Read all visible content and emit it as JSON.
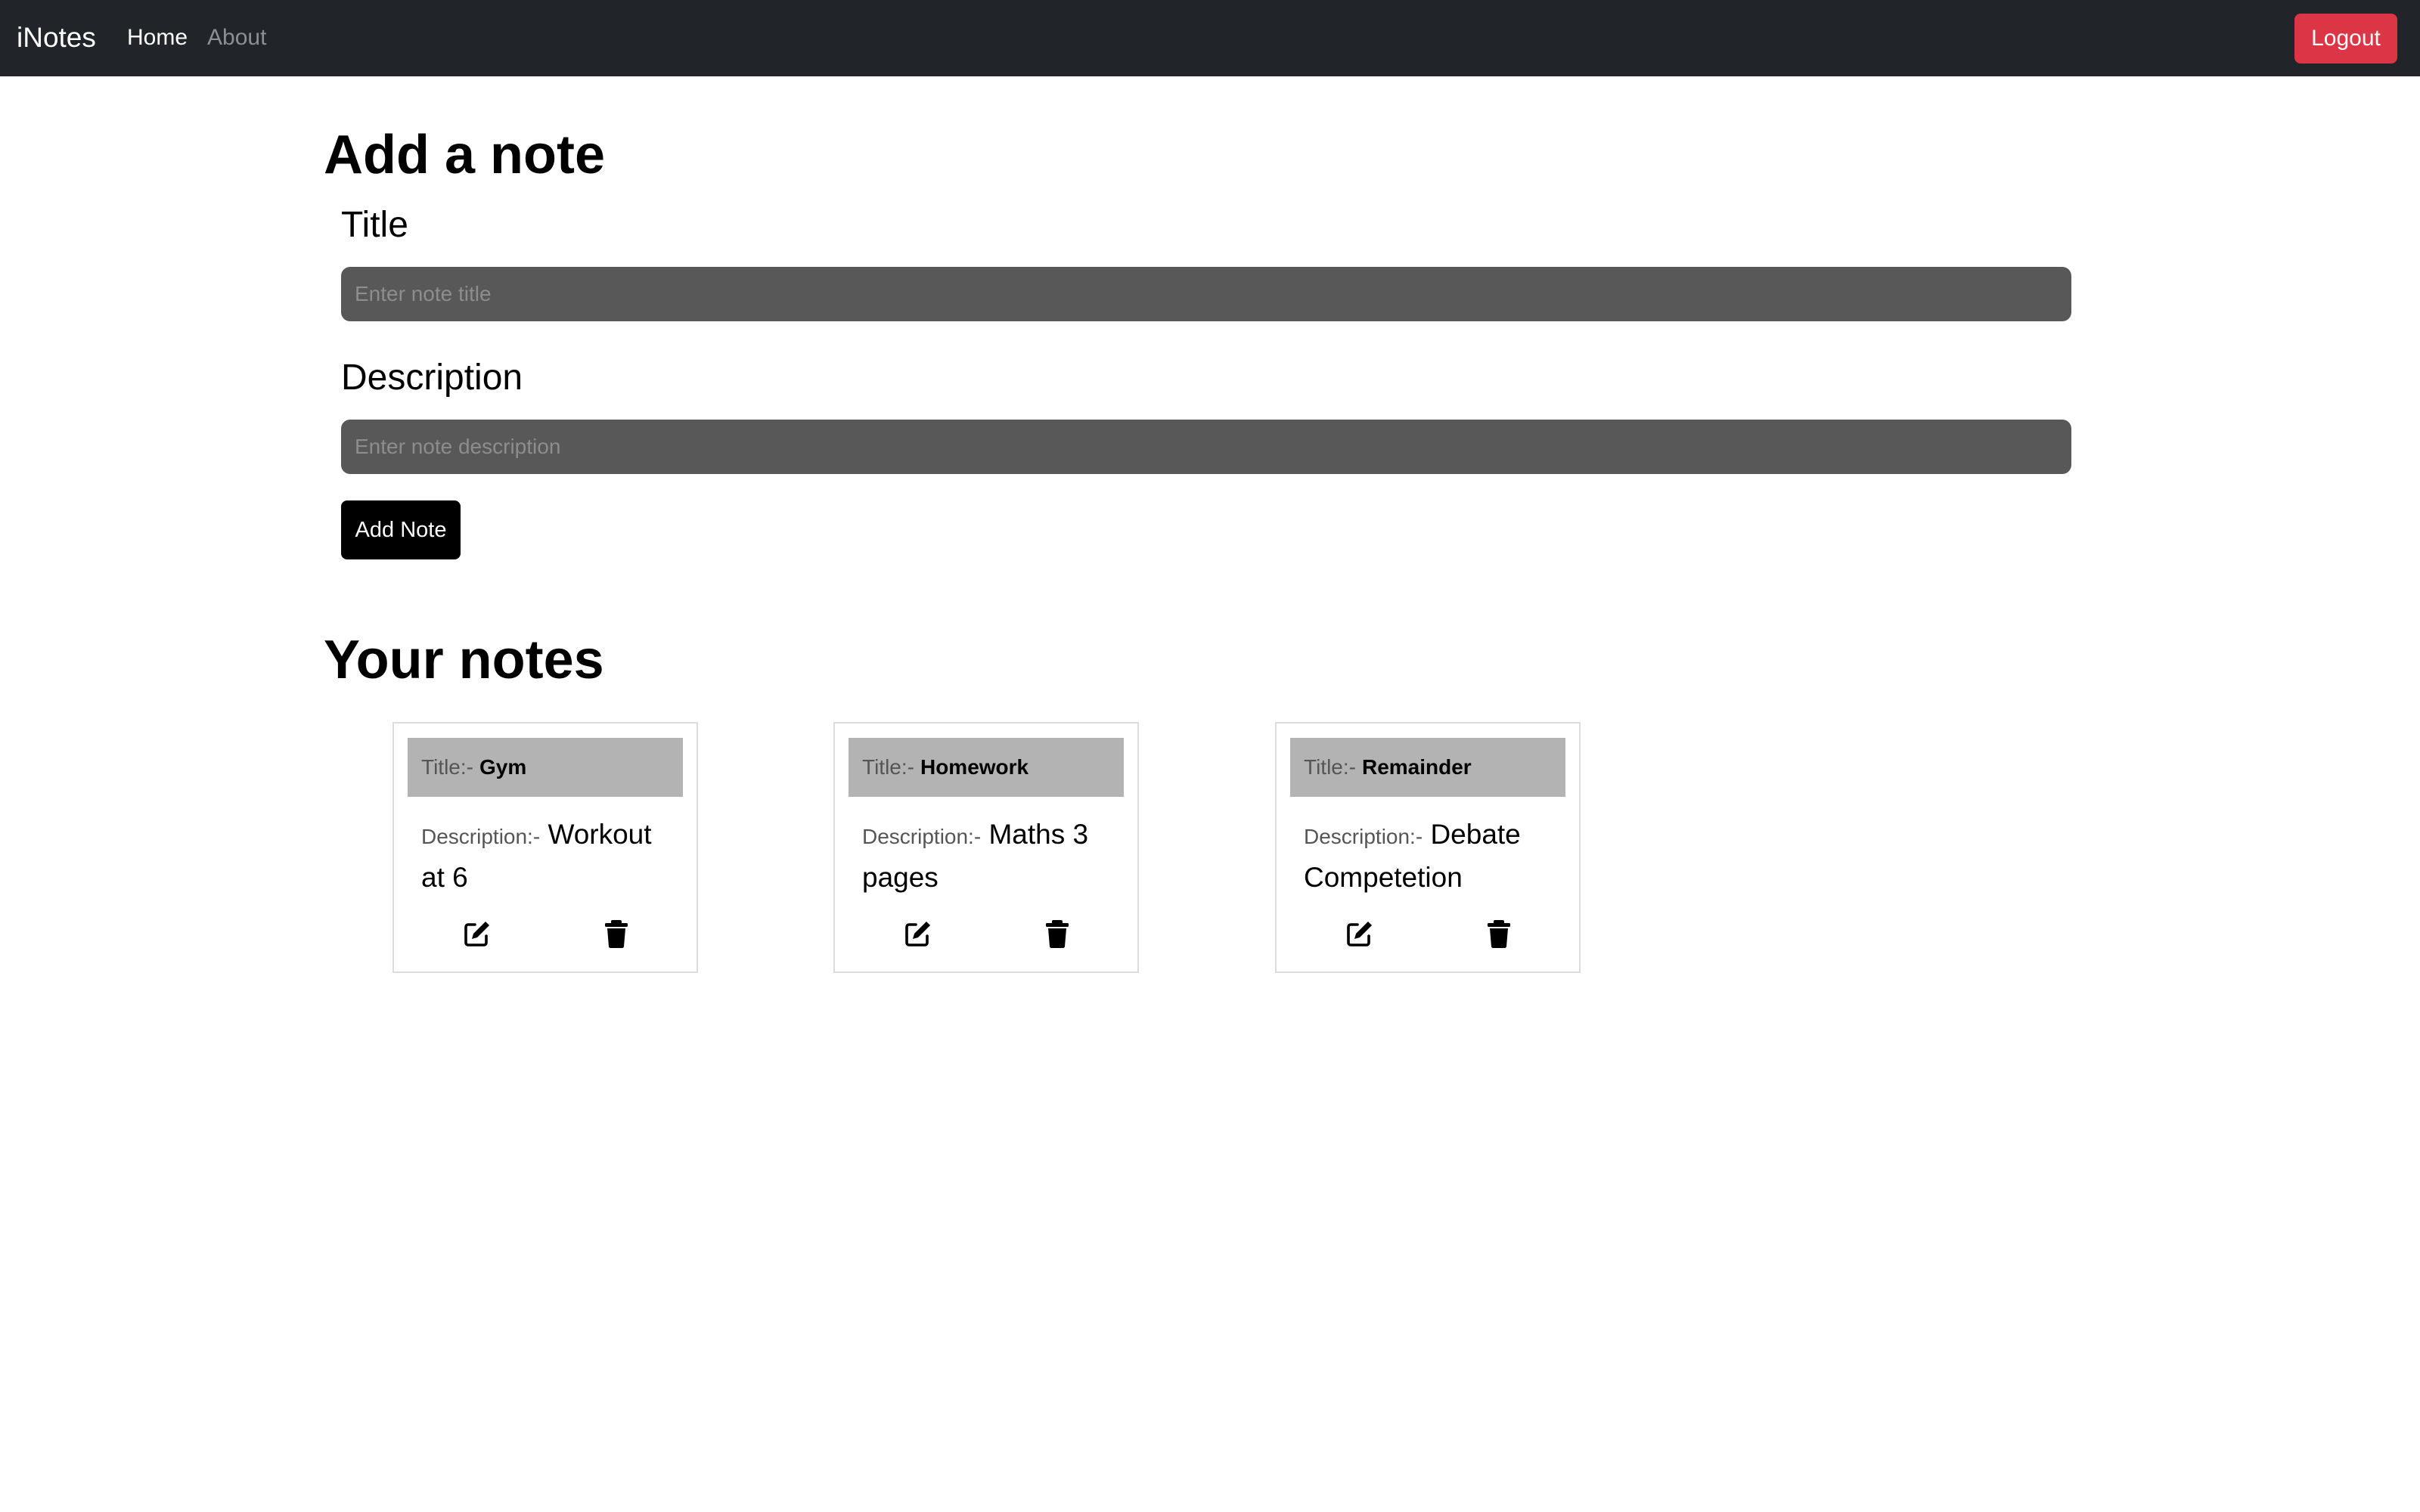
{
  "nav": {
    "brand": "iNotes",
    "links": [
      "Home",
      "About"
    ],
    "logout_label": "Logout"
  },
  "form": {
    "heading": "Add a note",
    "title_label": "Title",
    "title_placeholder": "Enter note title",
    "title_value": "",
    "description_label": "Description",
    "description_placeholder": "Enter note description",
    "description_value": "",
    "submit_label": "Add Note"
  },
  "notes": {
    "heading": "Your notes",
    "title_prefix": "Title:-",
    "description_prefix": "Description:-",
    "items": [
      {
        "title": "Gym",
        "description": "Workout at 6"
      },
      {
        "title": "Homework",
        "description": "Maths 3 pages"
      },
      {
        "title": "Remainder",
        "description": "Debate Competetion"
      }
    ],
    "edit_icon": "edit-icon",
    "delete_icon": "trash-icon"
  },
  "colors": {
    "navbar_bg": "#212529",
    "logout_bg": "#dc3545",
    "input_bg": "#585858",
    "card_header_bg": "#b3b3b3",
    "button_bg": "#000000"
  }
}
